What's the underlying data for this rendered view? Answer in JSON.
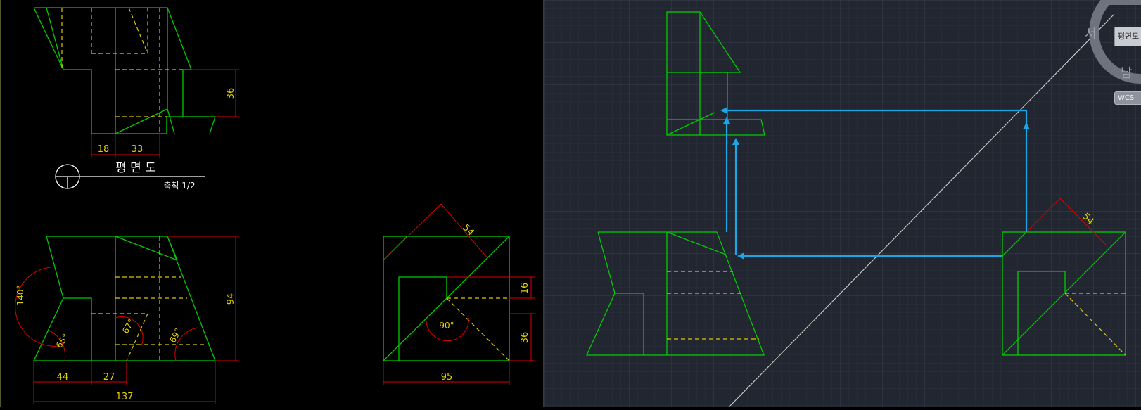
{
  "left_drawing": {
    "dims": {
      "plan_h": "36",
      "plan_w1": "18",
      "plan_w2": "33",
      "front_w1": "44",
      "front_w2": "27",
      "front_total": "137",
      "front_h": "94",
      "side_w": "95",
      "side_diag": "54",
      "side_h1": "16",
      "side_h2": "36"
    },
    "angles": {
      "a140": "140°",
      "a65": "65°",
      "a67": "67°",
      "a69": "69°",
      "a90": "90°"
    },
    "title": {
      "name": "평 면 도",
      "scale": "축척 1/2"
    }
  },
  "right_viewport": {
    "dim_diag": "54",
    "viewcube": {
      "face_label": "평면도",
      "west": "서",
      "south": "남"
    },
    "wcs_label": "WCS"
  },
  "colors": {
    "geometry": "#00cc00",
    "hidden": "#d8c800",
    "dimension": "#dd0000",
    "dim_text": "#e0d000",
    "arrow": "#1aa7e6",
    "construction": "#d0d0d0",
    "grid": "#2d333e",
    "grid_major": "#39404c"
  }
}
